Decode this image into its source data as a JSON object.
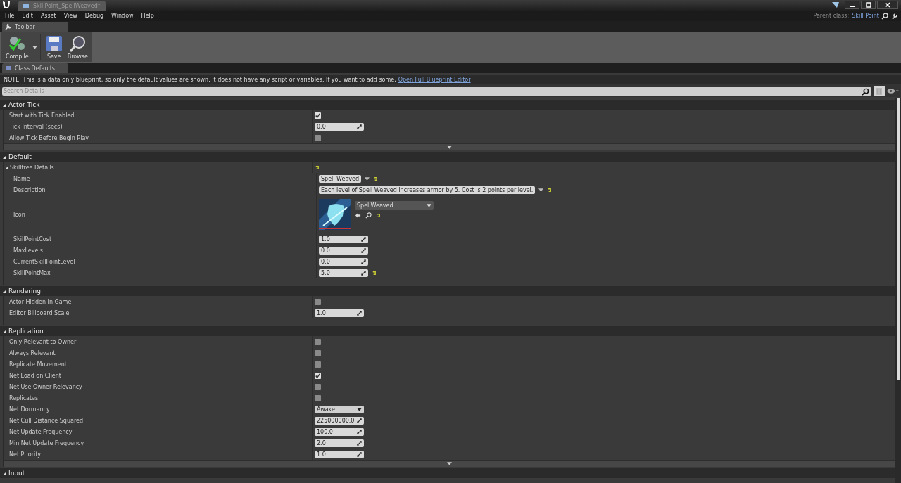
{
  "window": {
    "tab_title": "SkillPoint_SpellWeaved*"
  },
  "menu": [
    "File",
    "Edit",
    "Asset",
    "View",
    "Debug",
    "Window",
    "Help"
  ],
  "parent_class": {
    "label": "Parent class:",
    "value": "Skill Point"
  },
  "toolbar": {
    "tab": "Toolbar",
    "buttons": [
      {
        "kind": "compile",
        "label": "Compile"
      },
      {
        "kind": "save",
        "label": "Save"
      },
      {
        "kind": "browse",
        "label": "Browse"
      }
    ]
  },
  "details": {
    "tab": "Class Defaults",
    "note": "NOTE: This is a data only blueprint, so only the default values are shown.  It does not have any script or variables.  If you want to add some,",
    "note_link": "Open Full Blueprint Editor",
    "search": {
      "placeholder": "Search Details"
    }
  },
  "categories": [
    {
      "title": "Actor Tick",
      "advanced": true,
      "rows": [
        {
          "kind": "checkbox",
          "label": "Start with Tick Enabled",
          "checked": true
        },
        {
          "kind": "number",
          "label": "Tick Interval (secs)",
          "value": "0.0"
        },
        {
          "kind": "checkbox",
          "label": "Allow Tick Before Begin Play",
          "checked": false
        }
      ]
    },
    {
      "title": "Default",
      "advanced": false,
      "rows": [
        {
          "kind": "group",
          "label": "Skilltree Details",
          "reset": true,
          "children": [
            {
              "kind": "text",
              "label": "Name",
              "value": "Spell Weaved",
              "reset": true
            },
            {
              "kind": "text",
              "label": "Description",
              "value": "Each level of Spell Weaved increases armor by 5. Cost is 2 points per level.",
              "reset": true
            },
            {
              "kind": "asset",
              "label": "Icon",
              "value": "SpellWeaved",
              "reset": true
            },
            {
              "kind": "number",
              "label": "SkillPointCost",
              "value": "1.0",
              "reset": false
            },
            {
              "kind": "number",
              "label": "MaxLevels",
              "value": "0.0",
              "reset": false
            },
            {
              "kind": "number",
              "label": "CurrentSkillPointLevel",
              "value": "0.0",
              "reset": false
            },
            {
              "kind": "number",
              "label": "SkillPointMax",
              "value": "5.0",
              "reset": true
            }
          ]
        }
      ]
    },
    {
      "title": "Rendering",
      "advanced": false,
      "rows": [
        {
          "kind": "checkbox",
          "label": "Actor Hidden In Game",
          "checked": false
        },
        {
          "kind": "number",
          "label": "Editor Billboard Scale",
          "value": "1.0"
        }
      ]
    },
    {
      "title": "Replication",
      "advanced": true,
      "rows": [
        {
          "kind": "checkbox",
          "label": "Only Relevant to Owner",
          "checked": false
        },
        {
          "kind": "checkbox",
          "label": "Always Relevant",
          "checked": false
        },
        {
          "kind": "checkbox",
          "label": "Replicate Movement",
          "checked": false
        },
        {
          "kind": "checkbox",
          "label": "Net Load on Client",
          "checked": true
        },
        {
          "kind": "checkbox",
          "label": "Net Use Owner Relevancy",
          "checked": false
        },
        {
          "kind": "checkbox",
          "label": "Replicates",
          "checked": false
        },
        {
          "kind": "dropdown",
          "label": "Net Dormancy",
          "value": "Awake"
        },
        {
          "kind": "number",
          "label": "Net Cull Distance Squared",
          "value": "225000000.0"
        },
        {
          "kind": "number",
          "label": "Net Update Frequency",
          "value": "100.0"
        },
        {
          "kind": "number",
          "label": "Min Net Update Frequency",
          "value": "2.0"
        },
        {
          "kind": "number",
          "label": "Net Priority",
          "value": "1.0"
        }
      ]
    },
    {
      "title": "Input",
      "advanced": false
    }
  ]
}
